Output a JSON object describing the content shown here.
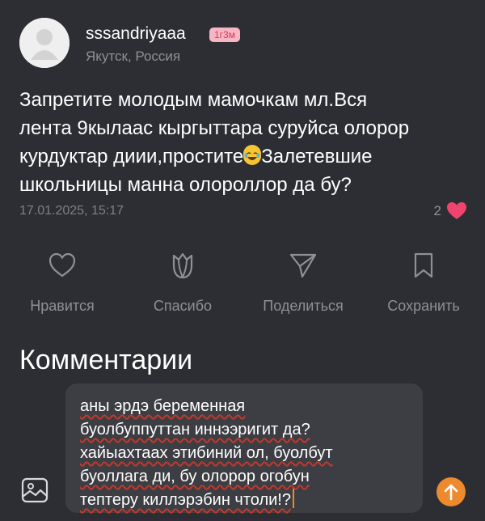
{
  "post": {
    "username": "sssandriyaaa",
    "time_badge": "1г3м",
    "location": "Якутск, Россия",
    "text_part1": "Запретите молодым мамочкам мл.Вся\nлента 9кылаас кыргыттара суруйса олорор\nкурдуктар диии,простите",
    "emoji": "laughing-tears-emoji",
    "text_part2": "Залетевшие\nшкольницы манна олороллор да бу?",
    "timestamp": "17.01.2025, 15:17",
    "likes_count": "2"
  },
  "actions": [
    {
      "label": "Нравится",
      "icon": "heart-outline-icon"
    },
    {
      "label": "Спасибо",
      "icon": "tulip-icon"
    },
    {
      "label": "Поделиться",
      "icon": "share-plane-icon"
    },
    {
      "label": "Сохранить",
      "icon": "bookmark-icon"
    }
  ],
  "comments": {
    "title": "Комментарии",
    "input_value": "аны эрдэ беременная\nбуолбуппуттан иннээригит да?\nхайыахтаах этибиний ол, буолбут\nбуоллага ди, бу олорор огобун\nтептеру киллэрэбин чтоли!?"
  },
  "colors": {
    "background": "#2c2e33",
    "accent_pink": "#f0446e",
    "send_orange": "#ee8a2e",
    "muted_text": "#8e9096"
  }
}
